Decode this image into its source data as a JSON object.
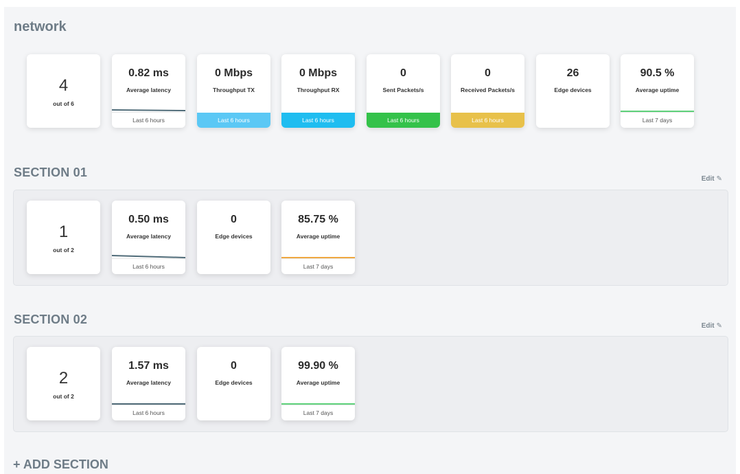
{
  "network": {
    "title": "network",
    "count": {
      "value": "4",
      "sub": "out of 6"
    },
    "cards": [
      {
        "value": "0.82 ms",
        "label": "Average latency",
        "footer": "Last 6 hours"
      },
      {
        "value": "0 Mbps",
        "label": "Throughput TX",
        "footer": "Last 6 hours"
      },
      {
        "value": "0 Mbps",
        "label": "Throughput RX",
        "footer": "Last 6 hours"
      },
      {
        "value": "0",
        "label": "Sent Packets/s",
        "footer": "Last 6 hours"
      },
      {
        "value": "0",
        "label": "Received Packets/s",
        "footer": "Last 6 hours"
      },
      {
        "value": "26",
        "label": "Edge devices"
      },
      {
        "value": "90.5 %",
        "label": "Average uptime",
        "footer": "Last 7 days"
      }
    ]
  },
  "sections": [
    {
      "title": "SECTION 01",
      "edit": "Edit",
      "count": {
        "value": "1",
        "sub": "out of 2"
      },
      "cards": [
        {
          "value": "0.50 ms",
          "label": "Average latency",
          "footer": "Last 6 hours"
        },
        {
          "value": "0",
          "label": "Edge devices"
        },
        {
          "value": "85.75 %",
          "label": "Average uptime",
          "footer": "Last 7 days"
        }
      ]
    },
    {
      "title": "SECTION 02",
      "edit": "Edit",
      "count": {
        "value": "2",
        "sub": "out of 2"
      },
      "cards": [
        {
          "value": "1.57 ms",
          "label": "Average latency",
          "footer": "Last 6 hours"
        },
        {
          "value": "0",
          "label": "Edge devices"
        },
        {
          "value": "99.90 %",
          "label": "Average uptime",
          "footer": "Last 7 days"
        }
      ]
    }
  ],
  "add_section": "+ ADD SECTION",
  "colors": {
    "tx": "#5bc8f5",
    "rx": "#1fbdf0",
    "sent": "#34c24a",
    "received": "#e8c14a",
    "latency_line": "#4f6b78",
    "uptime_green": "#5ed17a",
    "uptime_orange": "#f0a840"
  },
  "icons": {
    "edit": "pencil-icon"
  }
}
